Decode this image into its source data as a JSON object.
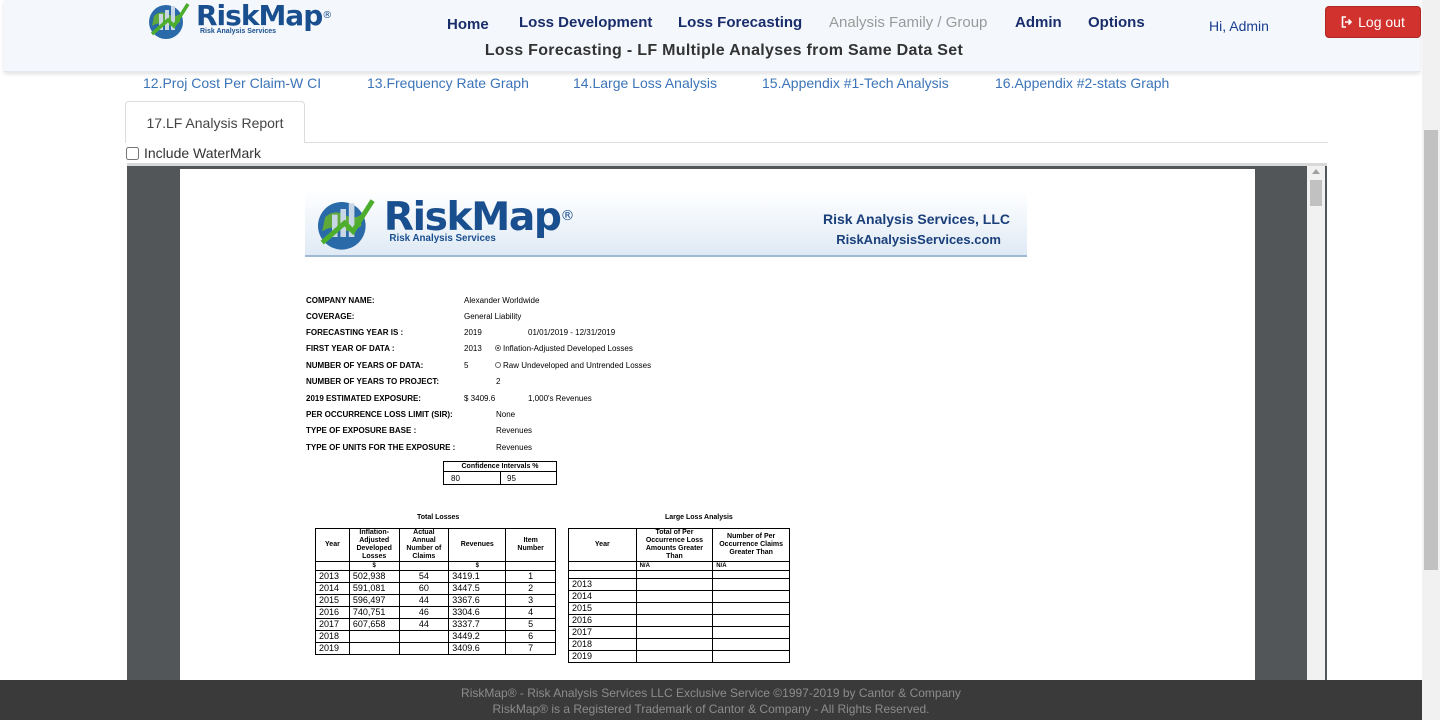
{
  "header": {
    "logo_text": "RiskMap",
    "logo_reg": "®",
    "logo_sub": "Risk Analysis Services",
    "nav": [
      "Home",
      "Loss Development",
      "Loss Forecasting",
      "Analysis Family / Group",
      "Admin",
      "Options"
    ],
    "greeting": "Hi, Admin",
    "logout_label": "Log out",
    "page_title": "Loss Forecasting - LF Multiple Analyses from Same Data Set"
  },
  "tabs": {
    "links": [
      "12.Proj Cost Per Claim-W CI",
      "13.Frequency Rate Graph",
      "14.Large Loss Analysis",
      "15.Appendix #1-Tech Analysis",
      "16.Appendix #2-stats Graph"
    ],
    "active": "17.LF Analysis Report",
    "watermark_label": "Include WaterMark"
  },
  "report": {
    "banner_company": "Risk Analysis Services, LLC",
    "banner_url": "RiskAnalysisServices.com",
    "fields": {
      "company_label": "COMPANY NAME:",
      "company": "Alexander Worldwide",
      "coverage_label": "COVERAGE:",
      "coverage": "General Liability",
      "fy_label": "FORECASTING YEAR IS :",
      "fy": "2019",
      "fy_range": "01/01/2019 - 12/31/2019",
      "first_label": "FIRST YEAR OF DATA :",
      "first": "2013",
      "opt1": "Inflation-Adjusted Developed Losses",
      "nyd_label": "NUMBER OF YEARS OF DATA:",
      "nyd": "5",
      "opt2": "Raw Undeveloped and Untrended Losses",
      "nyp_label": "NUMBER OF YEARS TO PROJECT:",
      "nyp": "2",
      "exp_year": "2019",
      "exp_label": "ESTIMATED EXPOSURE:",
      "exp": "$ 3409.6",
      "exp_unit": "1,000's Revenues",
      "sir_label": "PER OCCURRENCE LOSS LIMIT (SIR):",
      "sir": "None",
      "base_label": "TYPE OF EXPOSURE BASE :",
      "base": "Revenues",
      "units_label": "TYPE OF UNITS FOR THE EXPOSURE :",
      "units": "Revenues"
    },
    "ci": {
      "header": "Confidence Intervals %",
      "v1": "80",
      "v2": "95"
    },
    "total_losses": {
      "title": "Total Losses",
      "headers": [
        "Year",
        "Inflation-Adjusted Developed Losses",
        "Actual Annual Number of Claims",
        "Revenues",
        "Item Number"
      ],
      "units": [
        "",
        "$",
        "",
        "$",
        ""
      ],
      "rows": [
        [
          "2013",
          "502,938",
          "54",
          "3419.1",
          "1"
        ],
        [
          "2014",
          "591,081",
          "60",
          "3447.5",
          "2"
        ],
        [
          "2015",
          "596,497",
          "44",
          "3367.6",
          "3"
        ],
        [
          "2016",
          "740,751",
          "46",
          "3304.6",
          "4"
        ],
        [
          "2017",
          "607,658",
          "44",
          "3337.7",
          "5"
        ],
        [
          "2018",
          "",
          "",
          "3449.2",
          "6"
        ],
        [
          "2019",
          "",
          "",
          "3409.6",
          "7"
        ]
      ]
    },
    "large_loss": {
      "title": "Large Loss Analysis",
      "headers": [
        "Year",
        "Total of Per Occurrence Loss Amounts Greater Than",
        "Number of Per Occurrence Claims Greater Than"
      ],
      "units": [
        "",
        "N/A",
        "N/A"
      ],
      "years": [
        "2013",
        "2014",
        "2015",
        "2016",
        "2017",
        "2018",
        "2019"
      ]
    }
  },
  "footer": {
    "line1": "RiskMap® - Risk Analysis Services LLC Exclusive Service ©1997-2019 by Cantor & Company",
    "line2": "RiskMap® is a Registered Trademark of Cantor & Company - All Rights Reserved."
  }
}
